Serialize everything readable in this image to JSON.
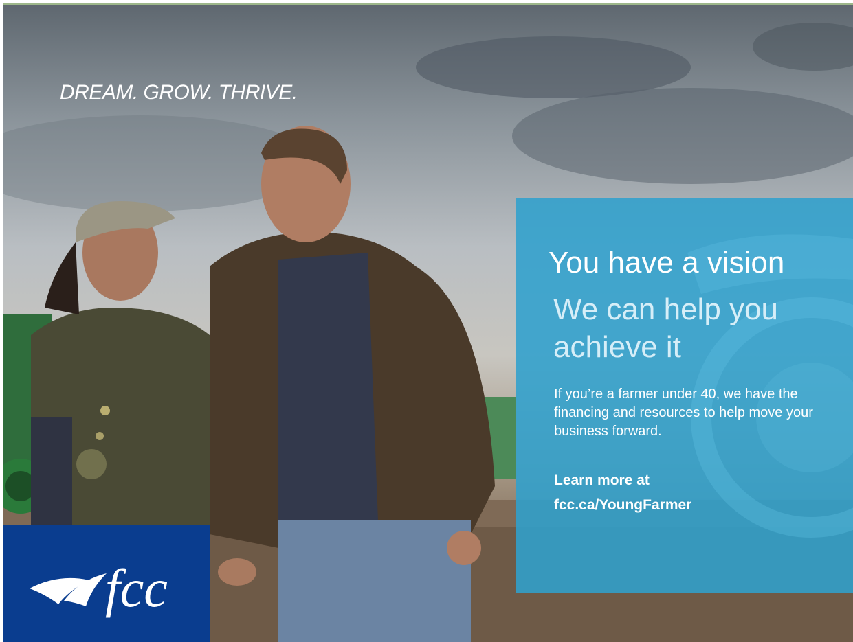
{
  "ad": {
    "tagline": "DREAM. GROW. THRIVE.",
    "headline": "You have a vision",
    "subheadline": "We can help you achieve it",
    "body": "If you’re a farmer under 40, we have the financing and resources to help move your business forward.",
    "cta_line1": "Learn more at",
    "cta_line2": "fcc.ca/YoungFarmer"
  },
  "logo": {
    "text": "fcc"
  },
  "colors": {
    "panel": "#30a0cd",
    "logo_bg": "#0a3d8f",
    "subhead": "#d6eef8"
  }
}
